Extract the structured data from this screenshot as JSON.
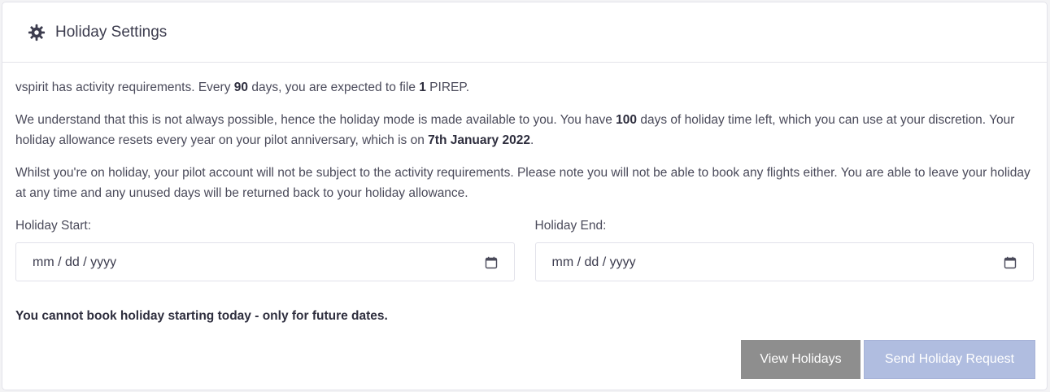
{
  "header": {
    "title": "Holiday Settings",
    "icon": "gear-icon"
  },
  "intro": {
    "prefix": "vspirit has activity requirements. Every ",
    "days": "90",
    "middle": " days, you are expected to file ",
    "count": "1",
    "suffix": " PIREP."
  },
  "allowance": {
    "prefix": "We understand that this is not always possible, hence the holiday mode is made available to you. You have ",
    "days": "100",
    "middle": " days of holiday time left, which you can use at your discretion. Your holiday allowance resets every year on your pilot anniversary, which is on ",
    "date": "7th January 2022",
    "suffix": "."
  },
  "notice": "Whilst you're on holiday, your pilot account will not be subject to the activity requirements. Please note you will not be able to book any flights either. You are able to leave your holiday at any time and any unused days will be returned back to your holiday allowance.",
  "form": {
    "start_label": "Holiday Start:",
    "start_value": "mm / dd / yyyy",
    "end_label": "Holiday End:",
    "end_value": "mm / dd / yyyy"
  },
  "warning": "You cannot book holiday starting today - only for future dates.",
  "buttons": {
    "view": "View Holidays",
    "send": "Send Holiday Request"
  },
  "colors": {
    "view_button": "#8e8e8e",
    "send_button": "#b0bde0"
  }
}
